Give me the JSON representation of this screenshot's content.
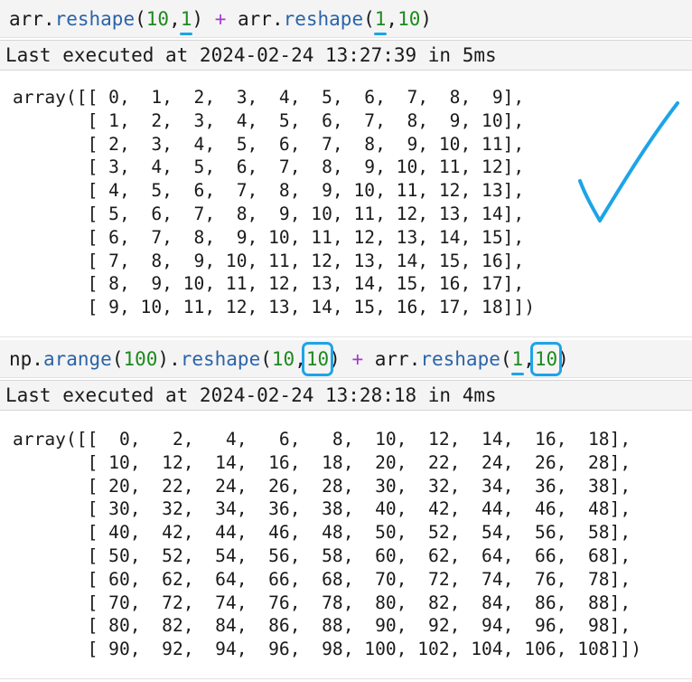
{
  "cells": [
    {
      "code": {
        "obj1": "arr",
        "dot1": ".",
        "fn1": "reshape",
        "open1": "(",
        "n1": "10",
        "comma1": ",",
        "n2": "1",
        "close1": ")",
        "plus": "+",
        "obj2": "arr",
        "dot2": ".",
        "fn2": "reshape",
        "open2": "(",
        "n3": "1",
        "comma2": ",",
        "n4": "10",
        "close2": ")"
      },
      "exec_status": "Last executed at 2024-02-24 13:27:39 in 5ms",
      "output": "array([[ 0,  1,  2,  3,  4,  5,  6,  7,  8,  9],\n       [ 1,  2,  3,  4,  5,  6,  7,  8,  9, 10],\n       [ 2,  3,  4,  5,  6,  7,  8,  9, 10, 11],\n       [ 3,  4,  5,  6,  7,  8,  9, 10, 11, 12],\n       [ 4,  5,  6,  7,  8,  9, 10, 11, 12, 13],\n       [ 5,  6,  7,  8,  9, 10, 11, 12, 13, 14],\n       [ 6,  7,  8,  9, 10, 11, 12, 13, 14, 15],\n       [ 7,  8,  9, 10, 11, 12, 13, 14, 15, 16],\n       [ 8,  9, 10, 11, 12, 13, 14, 15, 16, 17],\n       [ 9, 10, 11, 12, 13, 14, 15, 16, 17, 18]])"
    },
    {
      "code": {
        "obj1": "np",
        "dot1": ".",
        "fn1": "arange",
        "open1": "(",
        "n1": "100",
        "close1": ")",
        "dot2": ".",
        "fn2": "reshape",
        "open2": "(",
        "n2": "10",
        "comma1": ",",
        "n3": "10",
        "close2": ")",
        "plus": "+",
        "obj2": "arr",
        "dot3": ".",
        "fn3": "reshape",
        "open3": "(",
        "n4": "1",
        "comma2": ",",
        "n5": "10",
        "close3": ")"
      },
      "exec_status": "Last executed at 2024-02-24 13:28:18 in 4ms",
      "output": "array([[  0,   2,   4,   6,   8,  10,  12,  14,  16,  18],\n       [ 10,  12,  14,  16,  18,  20,  22,  24,  26,  28],\n       [ 20,  22,  24,  26,  28,  30,  32,  34,  36,  38],\n       [ 30,  32,  34,  36,  38,  40,  42,  44,  46,  48],\n       [ 40,  42,  44,  46,  48,  50,  52,  54,  56,  58],\n       [ 50,  52,  54,  56,  58,  60,  62,  64,  66,  68],\n       [ 60,  62,  64,  66,  68,  70,  72,  74,  76,  78],\n       [ 70,  72,  74,  76,  78,  80,  82,  84,  86,  88],\n       [ 80,  82,  84,  86,  88,  90,  92,  94,  96,  98],\n       [ 90,  92,  94,  96,  98, 100, 102, 104, 106, 108]])"
    }
  ],
  "colors": {
    "annotation": "#1da4e8",
    "keyword_fn": "#2a64a8",
    "number": "#1d8a1d",
    "operator": "#a33ad0",
    "cell_bg": "#f4f4f4"
  },
  "icons": {
    "annotation_mark": "checkmark-icon"
  }
}
